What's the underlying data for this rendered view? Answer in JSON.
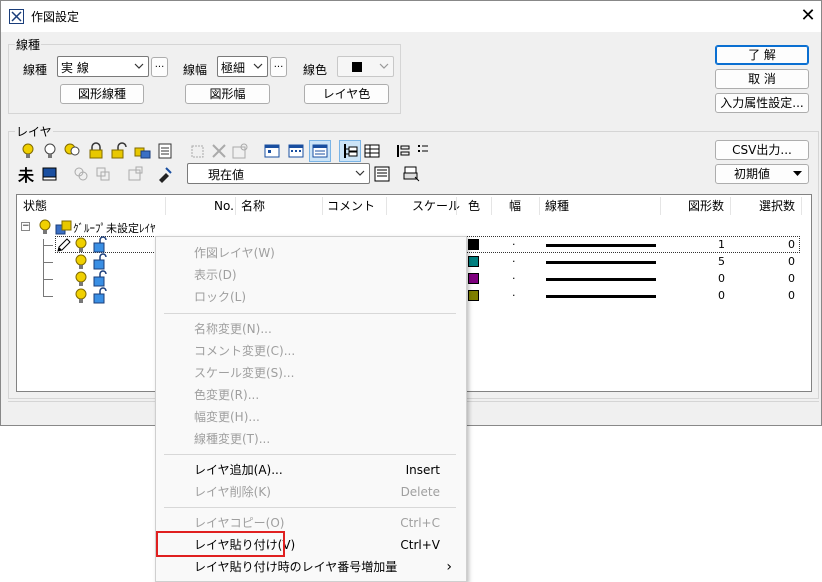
{
  "window": {
    "title": "作図設定",
    "close_glyph": "✕"
  },
  "linetype_group": {
    "title": "線種",
    "linetype_label": "線種",
    "linetype_value": "実 線",
    "linewidth_label": "線幅",
    "linewidth_value": "極細",
    "linecolor_label": "線色",
    "more_label": "...",
    "shape_linetype_button": "図形線種",
    "shape_width_button": "図形幅",
    "layer_color_button": "レイヤ色"
  },
  "right_buttons": {
    "ok": "了 解",
    "cancel": "取 消",
    "input_attr": "入力属性設定...",
    "csv": "CSV出力...",
    "initial": "初期値"
  },
  "layer_group": {
    "title": "レイヤ",
    "current_value": "現在値",
    "top_left_glyph": "未"
  },
  "list": {
    "columns": [
      "状態",
      "No.",
      "名称",
      "コメント",
      "スケール",
      "色",
      "幅",
      "線種",
      "図形数",
      "選択数"
    ],
    "group_row_label": "ｸﾞﾙｰﾌﾟ未設定ﾚｲﾔ",
    "rows": [
      {
        "color": "#000000",
        "width": "·",
        "count": "1",
        "selected": "0"
      },
      {
        "color": "#007f7f",
        "width": "·",
        "count": "5",
        "selected": "0"
      },
      {
        "color": "#7f007f",
        "width": "·",
        "count": "0",
        "selected": "0"
      },
      {
        "color": "#7f7f00",
        "width": "·",
        "count": "0",
        "selected": "0"
      }
    ]
  },
  "context_menu": {
    "items": [
      {
        "label": "作図レイヤ(W)",
        "shortcut": "",
        "disabled": true
      },
      {
        "label": "表示(D)",
        "shortcut": "",
        "disabled": true
      },
      {
        "label": "ロック(L)",
        "shortcut": "",
        "disabled": true
      },
      {
        "label": "名称変更(N)...",
        "shortcut": "",
        "disabled": true
      },
      {
        "label": "コメント変更(C)...",
        "shortcut": "",
        "disabled": true
      },
      {
        "label": "スケール変更(S)...",
        "shortcut": "",
        "disabled": true
      },
      {
        "label": "色変更(R)...",
        "shortcut": "",
        "disabled": true
      },
      {
        "label": "幅変更(H)...",
        "shortcut": "",
        "disabled": true
      },
      {
        "label": "線種変更(T)...",
        "shortcut": "",
        "disabled": true
      },
      {
        "label": "レイヤ追加(A)...",
        "shortcut": "Insert",
        "disabled": false
      },
      {
        "label": "レイヤ削除(K)",
        "shortcut": "Delete",
        "disabled": true
      },
      {
        "label": "レイヤコピー(O)",
        "shortcut": "Ctrl+C",
        "disabled": true
      },
      {
        "label": "レイヤ貼り付け(V)",
        "shortcut": "Ctrl+V",
        "disabled": false
      },
      {
        "label": "レイヤ貼り付け時のレイヤ番号増加量",
        "shortcut": "",
        "disabled": false
      }
    ],
    "submenu_arrow": "›"
  }
}
